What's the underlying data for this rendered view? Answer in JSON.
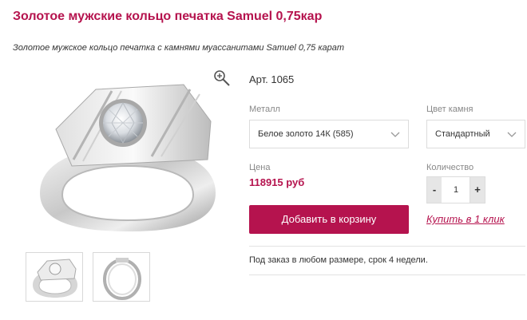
{
  "product": {
    "title": "Золотое мужские кольцо печатка Samuel 0,75кар",
    "subtitle": "Золотое мужское кольцо печатка с камнями муассанитами Samuel 0,75 карат",
    "sku": "Арт. 1065",
    "note": "Под заказ в любом размере, срок 4 недели."
  },
  "options": {
    "metal_label": "Металл",
    "metal_value": "Белое золото 14К (585)",
    "stone_label": "Цвет камня",
    "stone_value": "Стандартный"
  },
  "pricing": {
    "price_label": "Цена",
    "price_value": "118915 руб"
  },
  "quantity": {
    "label": "Количество",
    "minus": "-",
    "value": "1",
    "plus": "+"
  },
  "actions": {
    "add_to_cart": "Добавить в корзину",
    "buy_one_click": "Купить в 1 клик"
  },
  "icons": {
    "zoom": "zoom-in-icon",
    "select_arrow": "chevron-down-icon"
  },
  "colors": {
    "accent": "#b5134e"
  }
}
